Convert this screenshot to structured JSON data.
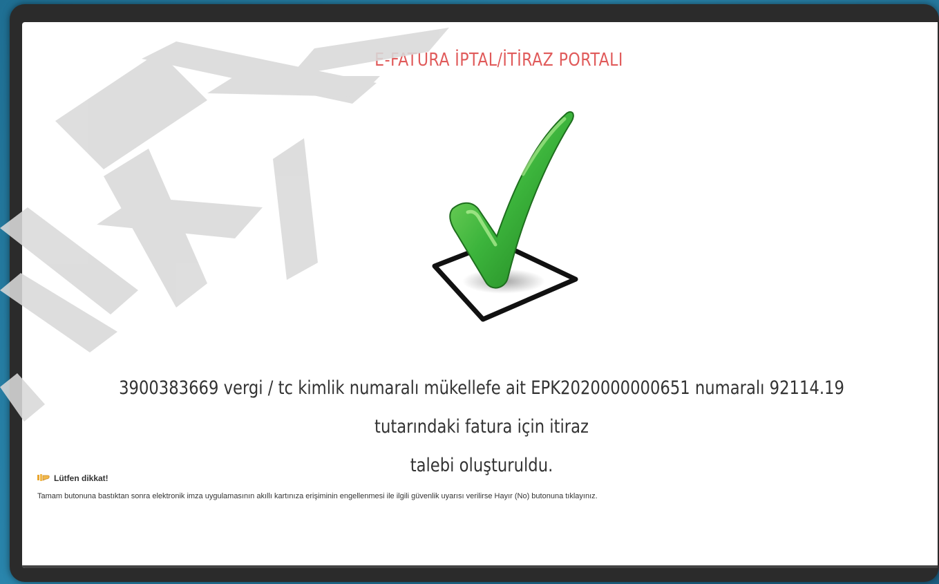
{
  "portal": {
    "title": "E-FATURA İPTAL/İTİRAZ PORTALI"
  },
  "result": {
    "icon": "checkmark-checkbox-icon",
    "message_line1": "3900383669 vergi / tc kimlik numaralı mükellefe ait EPK2020000000651 numaralı 92114.19 tutarındaki fatura için itiraz",
    "message_line2": "talebi oluşturuldu."
  },
  "notice": {
    "icon": "hand-pointer-icon",
    "heading": "Lütfen dikkat!",
    "body": "Tamam butonuna bastıktan sonra elektronik imza uygulamasının akıllı kartınıza erişiminin engellenmesi ile ilgili güvenlik uyarısı verilirse Hayır (No) butonuna tıklayınız."
  },
  "colors": {
    "title": "#e05a5a",
    "check_green": "#3cb43c",
    "background_blue": "#2a86ad",
    "frame": "#2b2b2b",
    "watermark": "#d9d9d9"
  }
}
